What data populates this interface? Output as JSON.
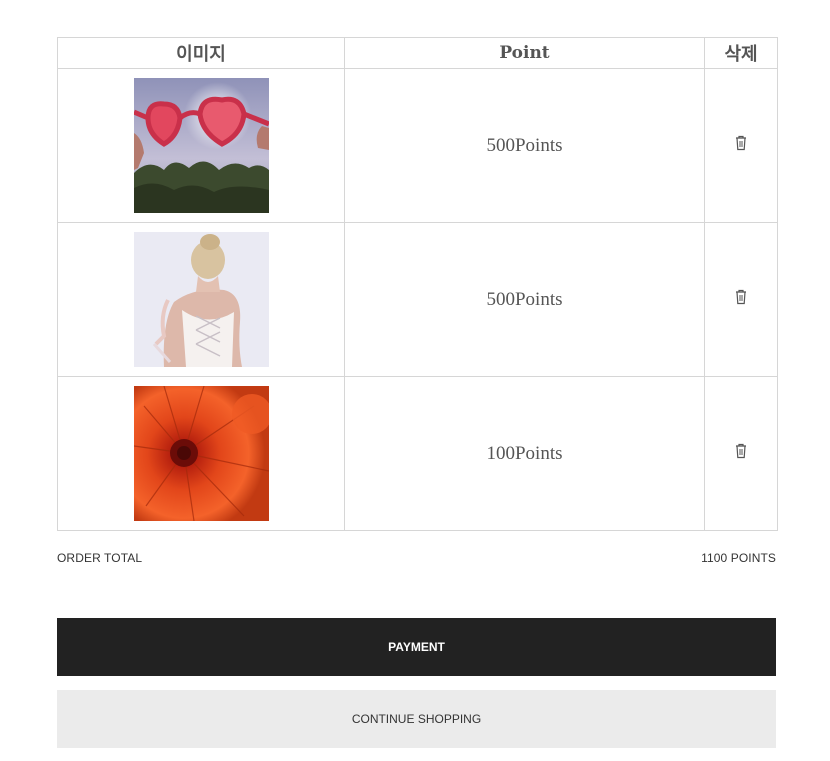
{
  "table": {
    "headers": {
      "image": "이미지",
      "point": "Point",
      "delete": "삭제"
    },
    "rows": [
      {
        "image": "heart-shaped red sunglasses held against sky",
        "points": "500Points",
        "delete_icon": "trash-icon"
      },
      {
        "image": "woman from behind in white lace-up top",
        "points": "500Points",
        "delete_icon": "trash-icon"
      },
      {
        "image": "orange chrysanthemum flower",
        "points": "100Points",
        "delete_icon": "trash-icon"
      }
    ]
  },
  "summary": {
    "label": "ORDER TOTAL",
    "value": "1100 POINTS"
  },
  "actions": {
    "payment": "PAYMENT",
    "continue": "CONTINUE SHOPPING"
  }
}
